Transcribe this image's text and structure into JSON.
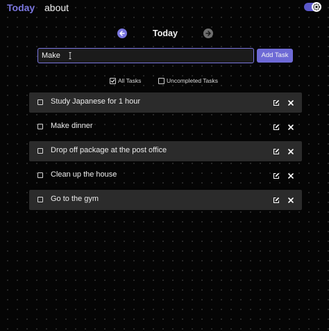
{
  "nav": {
    "today_label": "Today",
    "about_label": "about"
  },
  "theme_toggle": {
    "state": "dark",
    "icon": "gear-icon",
    "accent": "#5b58c9"
  },
  "date_nav": {
    "title": "Today",
    "prev_icon": "arrow-left-icon",
    "next_icon": "arrow-right-icon"
  },
  "new_task": {
    "value": "Make",
    "add_label": "Add Task"
  },
  "filters": [
    {
      "label": "All Tasks",
      "checked": true
    },
    {
      "label": "Uncompleted Tasks",
      "checked": false
    }
  ],
  "tasks": [
    {
      "text": "Study Japanese for 1 hour",
      "completed": false
    },
    {
      "text": "Make dinner",
      "completed": false
    },
    {
      "text": "Drop off package at the post office",
      "completed": false
    },
    {
      "text": "Clean up the house",
      "completed": false
    },
    {
      "text": "Go to the gym",
      "completed": false
    }
  ],
  "colors": {
    "accent": "#7b77e0",
    "background": "#050505",
    "row_shade": "#2b2b2b"
  }
}
